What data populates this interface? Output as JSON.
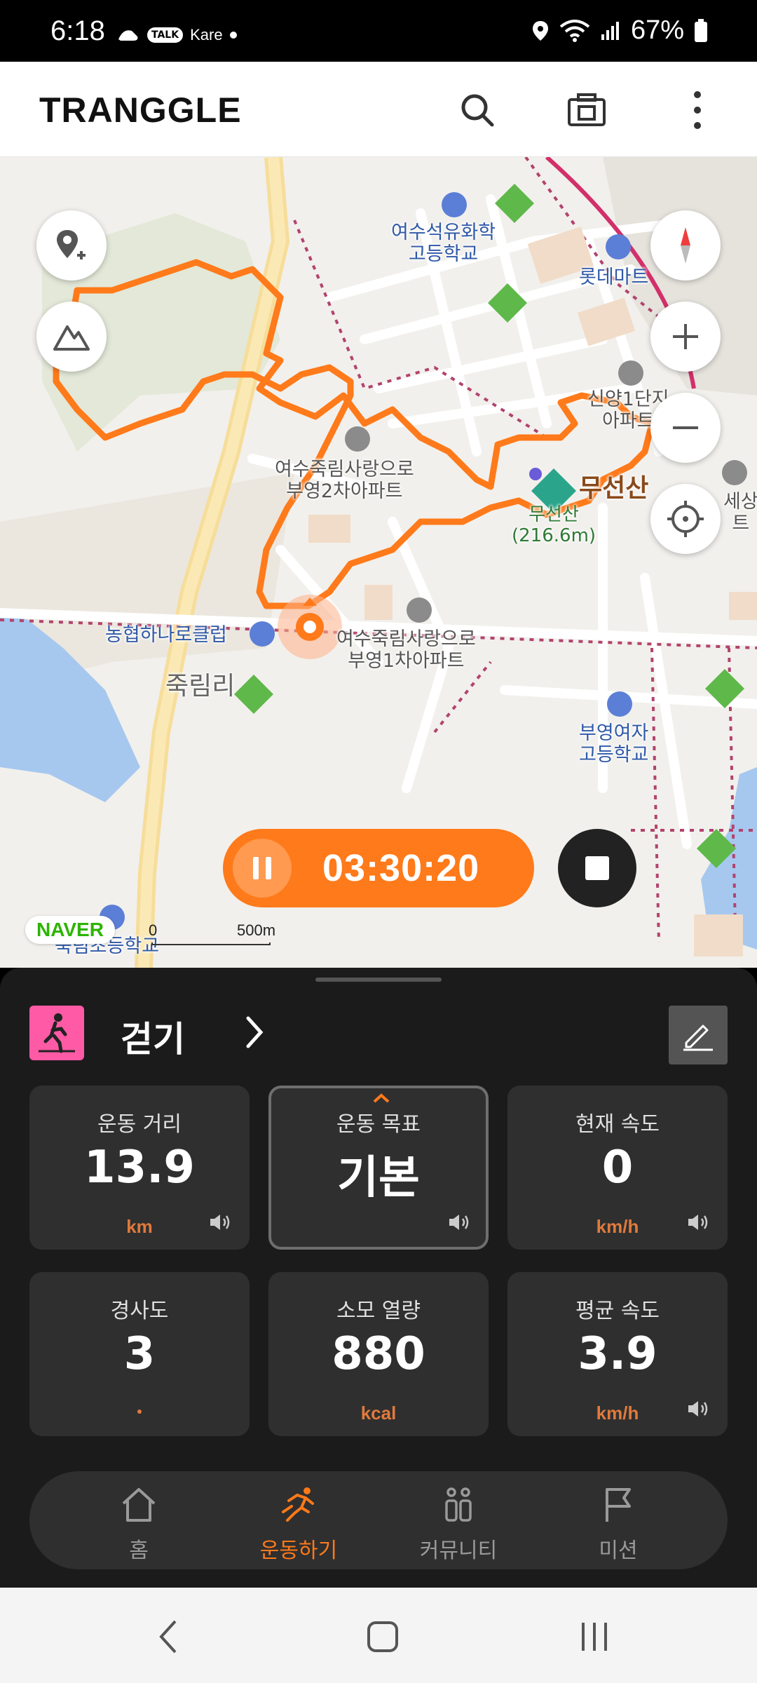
{
  "status_bar": {
    "time": "6:18",
    "app_labels": [
      "TALK",
      "Kare"
    ],
    "battery": "67%"
  },
  "header": {
    "logo": "TRANGGLE"
  },
  "map": {
    "labels": {
      "school1": "여수석유화학\n고등학교",
      "lotte": "롯데마트",
      "apt_shinyang": "신양1단지\n아파트",
      "apt_bu2": "여수죽림사랑으로\n부영2차아파트",
      "mountain": "무선산",
      "peak": "무선산\n(216.6m)",
      "apt_bu1": "여수죽림사랑으로\n부영1차아파트",
      "club": "농협하나로클럽",
      "area": "죽림리",
      "school2": "부영여자\n고등학교",
      "apt_edge": "세상\n트",
      "school3": "죽림초등학교"
    },
    "timer": "03:30:20",
    "naver": "NAVER",
    "scale_zero": "0",
    "scale_text": "500m",
    "route_color": "#ff7a1a"
  },
  "panel": {
    "activity": "걷기",
    "metrics": [
      {
        "label": "운동 거리",
        "value": "13.9",
        "unit": "km"
      },
      {
        "label": "운동 목표",
        "value": "기본",
        "unit": ""
      },
      {
        "label": "현재 속도",
        "value": "0",
        "unit": "km/h"
      },
      {
        "label": "경사도",
        "value": "3",
        "unit": ""
      },
      {
        "label": "소모 열량",
        "value": "880",
        "unit": "kcal"
      },
      {
        "label": "평균 속도",
        "value": "3.9",
        "unit": "km/h"
      }
    ],
    "nav": [
      {
        "label": "홈",
        "icon": "home-icon"
      },
      {
        "label": "운동하기",
        "icon": "running-icon"
      },
      {
        "label": "커뮤니티",
        "icon": "community-icon"
      },
      {
        "label": "미션",
        "icon": "flag-icon"
      }
    ]
  },
  "colors": {
    "accent": "#ff7a1a",
    "panel_bg": "#1b1b1b",
    "card_bg": "#2f2f2f",
    "activity_icon_bg": "#ff5aa5"
  }
}
